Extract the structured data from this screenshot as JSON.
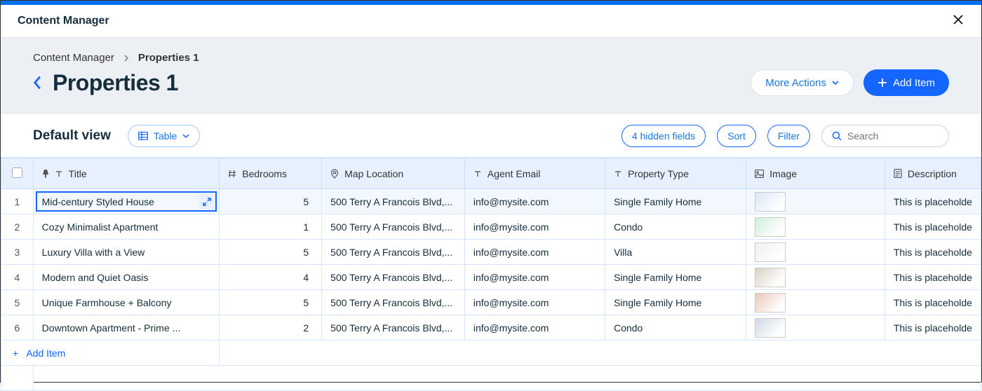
{
  "app_title": "Content Manager",
  "breadcrumb": {
    "root": "Content Manager",
    "current": "Properties 1"
  },
  "page_title": "Properties 1",
  "actions": {
    "more": "More Actions",
    "add": "Add Item"
  },
  "view": {
    "name": "Default view",
    "mode": "Table"
  },
  "toolbar": {
    "hidden_fields": "4 hidden fields",
    "sort": "Sort",
    "filter": "Filter",
    "search_placeholder": "Search"
  },
  "columns": {
    "title": "Title",
    "bedrooms": "Bedrooms",
    "map": "Map Location",
    "email": "Agent Email",
    "ptype": "Property Type",
    "image": "Image",
    "desc": "Description"
  },
  "rows": [
    {
      "idx": "1",
      "title": "Mid-century Styled House",
      "bedrooms": "5",
      "map": "500 Terry A Francois Blvd,...",
      "email": "info@mysite.com",
      "ptype": "Single Family Home",
      "desc": "This is placeholde",
      "thumb": "#d8e8f5"
    },
    {
      "idx": "2",
      "title": "Cozy Minimalist Apartment",
      "bedrooms": "1",
      "map": "500 Terry A Francois Blvd,...",
      "email": "info@mysite.com",
      "ptype": "Condo",
      "desc": "This is placeholde",
      "thumb": "#cfeedd"
    },
    {
      "idx": "3",
      "title": "Luxury Villa with a View",
      "bedrooms": "5",
      "map": "500 Terry A Francois Blvd,...",
      "email": "info@mysite.com",
      "ptype": "Villa",
      "desc": "This is placeholde",
      "thumb": "#f0f0f0"
    },
    {
      "idx": "4",
      "title": "Modern and Quiet Oasis",
      "bedrooms": "4",
      "map": "500 Terry A Francois Blvd,...",
      "email": "info@mysite.com",
      "ptype": "Single Family Home",
      "desc": "This is placeholde",
      "thumb": "#d8d2c4"
    },
    {
      "idx": "5",
      "title": "Unique Farmhouse + Balcony",
      "bedrooms": "5",
      "map": "500 Terry A Francois Blvd,...",
      "email": "info@mysite.com",
      "ptype": "Single Family Home",
      "desc": "This is placeholde",
      "thumb": "#e9c7b8"
    },
    {
      "idx": "6",
      "title": "Downtown Apartment - Prime ...",
      "bedrooms": "2",
      "map": "500 Terry A Francois Blvd,...",
      "email": "info@mysite.com",
      "ptype": "Condo",
      "desc": "This is placeholde",
      "thumb": "#cfd9e6"
    }
  ],
  "add_row_label": "Add Item"
}
